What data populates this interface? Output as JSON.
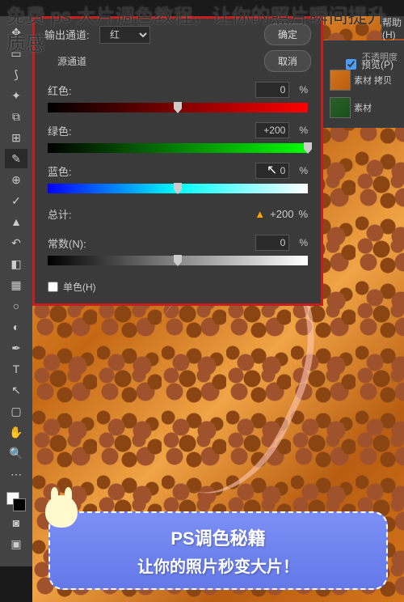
{
  "overlay_title": "免费 ps 大片调色教程，让你的照片瞬间提升质感",
  "dialog": {
    "confirm": "确定",
    "cancel": "取消",
    "channel_label": "输出通道:",
    "channel_value": "红",
    "preview_label": "预览(P)",
    "section": "源通道",
    "red_label": "红色:",
    "red_value": "0",
    "green_label": "绿色:",
    "green_value": "+200",
    "blue_label": "蓝色:",
    "blue_value": "0",
    "total_label": "总计:",
    "total_value": "+200",
    "const_label": "常数(N):",
    "const_value": "0",
    "mono_label": "单色(H)",
    "pct": "%"
  },
  "panel": {
    "opacity_label": "不透明度",
    "layer1": "素材 拷贝",
    "layer2": "素材"
  },
  "badge": {
    "line1": "PS调色秘籍",
    "line2": "让你的照片秒变大片！"
  },
  "help": "帮助(H)"
}
